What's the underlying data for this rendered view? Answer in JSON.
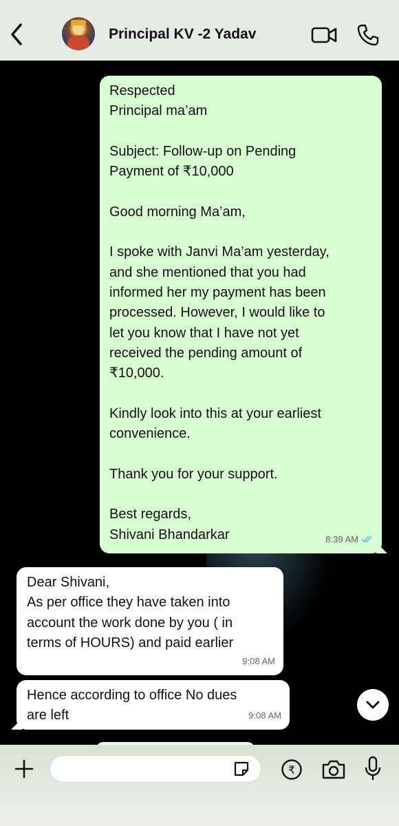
{
  "header": {
    "back_icon": "chevron-left-icon",
    "contact_name": "Principal KV -2 Yadav",
    "video_icon": "video-camera-icon",
    "call_icon": "phone-icon"
  },
  "messages": [
    {
      "direction": "outgoing",
      "lines": [
        "Respected",
        "Principal ma’am",
        "",
        "Subject: Follow-up on Pending",
        "Payment of ₹10,000",
        "",
        "Good morning Ma’am,",
        "",
        "I spoke with Janvi Ma’am yesterday,",
        "and she mentioned that you had",
        "informed her my payment has been",
        "processed. However, I would like to",
        "let you know that I have not yet",
        "received the pending amount of",
        "₹10,000.",
        "",
        "Kindly look into this at your earliest",
        "convenience.",
        "",
        "Thank you for your support.",
        "",
        "Best regards,",
        "Shivani Bhandarkar"
      ],
      "time": "8:39 AM",
      "status_icon": "double-check-read-icon"
    },
    {
      "direction": "incoming",
      "lines": [
        "Dear Shivani,",
        "As per office they have taken into",
        "account the work done by you ( in",
        "terms of HOURS) and paid earlier"
      ],
      "time": "9:08 AM"
    },
    {
      "direction": "incoming",
      "lines": [
        "Hence according to office No dues",
        "are left"
      ],
      "time": "9:08 AM"
    }
  ],
  "bottom_bar": {
    "plus_icon": "plus-icon",
    "input_value": "",
    "sticker_icon": "sticker-icon",
    "payment_icon": "rupee-icon",
    "camera_icon": "camera-icon",
    "mic_icon": "microphone-icon"
  },
  "colors": {
    "outgoing_bubble": "#d9fdd3",
    "incoming_bubble": "#ffffff",
    "header_bg": "#e7ebe6",
    "read_tick": "#53bdeb"
  }
}
